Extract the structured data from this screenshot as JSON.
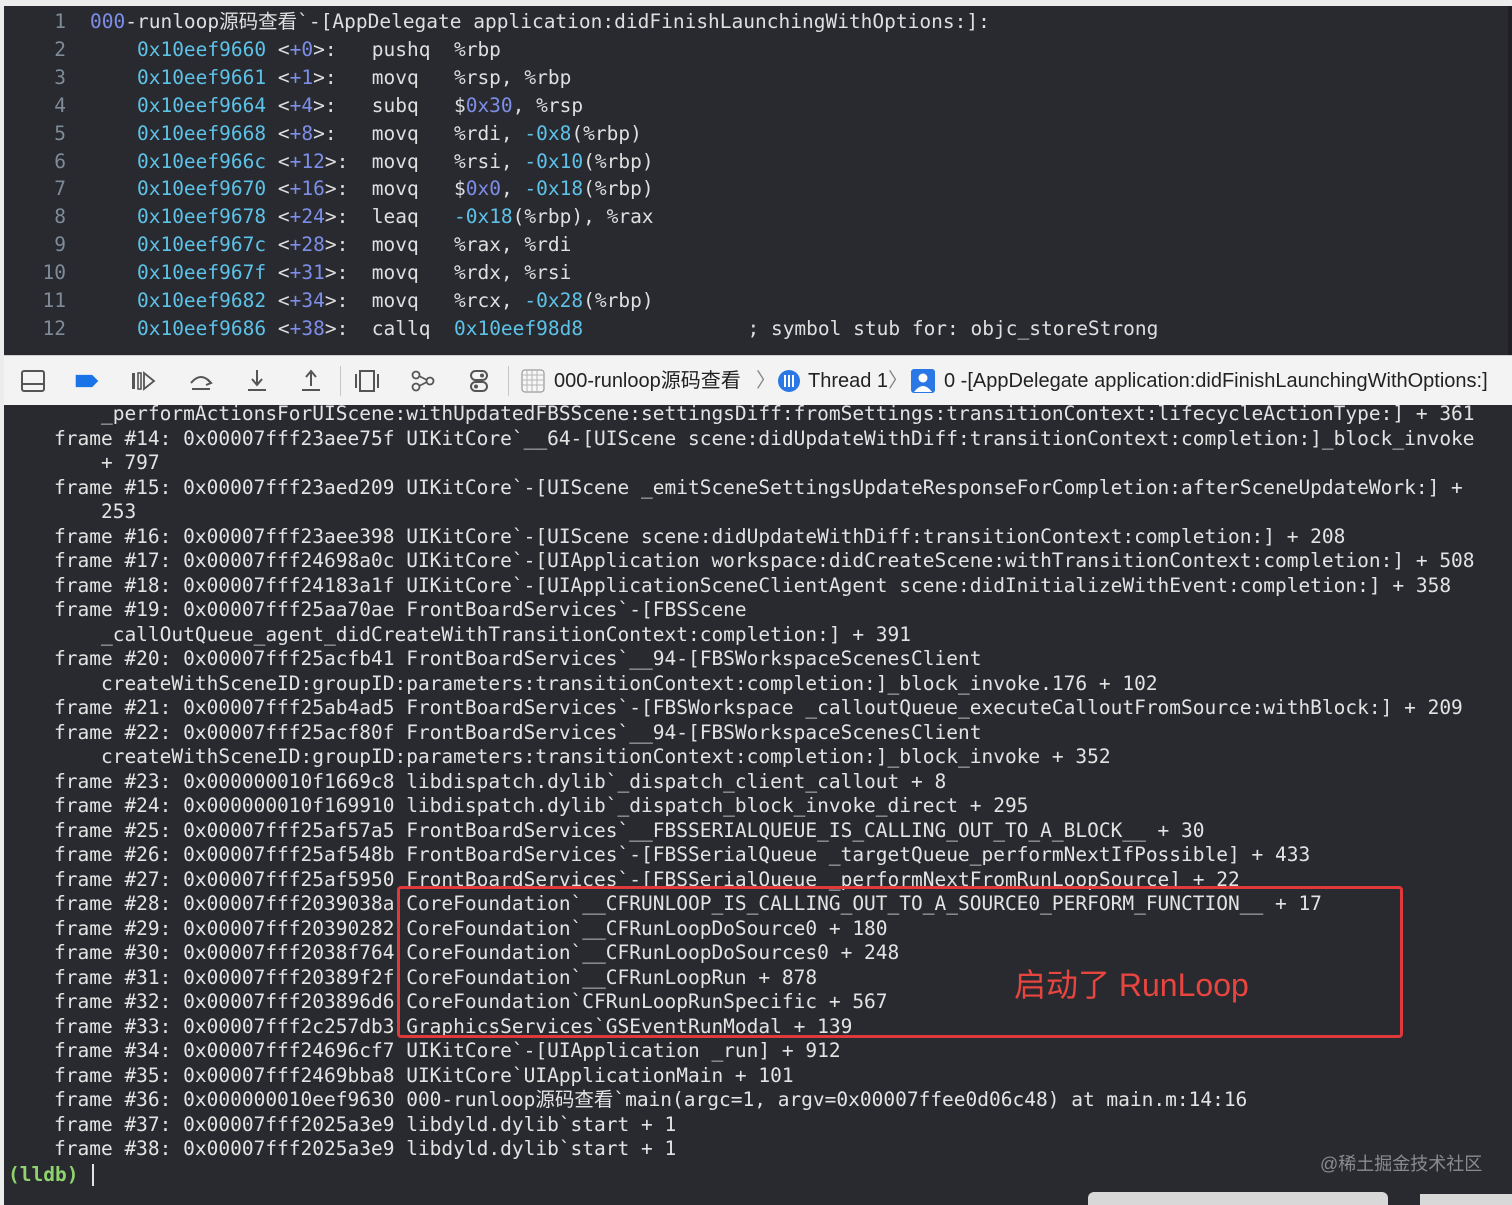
{
  "disassembly": {
    "lines": [
      {
        "n": "1",
        "segs": [
          [
            "num",
            "000"
          ],
          [
            "t",
            "-runloop源码查看`-[AppDelegate application:didFinishLaunchingWithOptions:]:"
          ]
        ]
      },
      {
        "n": "2",
        "segs": [
          [
            "t",
            "    "
          ],
          [
            "addr",
            "0x10eef9660"
          ],
          [
            "t",
            " <"
          ],
          [
            "num",
            "+0"
          ],
          [
            "t",
            ">:   pushq  %rbp"
          ]
        ]
      },
      {
        "n": "3",
        "segs": [
          [
            "t",
            "    "
          ],
          [
            "addr",
            "0x10eef9661"
          ],
          [
            "t",
            " <"
          ],
          [
            "num",
            "+1"
          ],
          [
            "t",
            ">:   movq   %rsp, %rbp"
          ]
        ]
      },
      {
        "n": "4",
        "segs": [
          [
            "t",
            "    "
          ],
          [
            "addr",
            "0x10eef9664"
          ],
          [
            "t",
            " <"
          ],
          [
            "num",
            "+4"
          ],
          [
            "t",
            ">:   subq   $"
          ],
          [
            "num",
            "0x30"
          ],
          [
            "t",
            ", %rsp"
          ]
        ]
      },
      {
        "n": "5",
        "segs": [
          [
            "t",
            "    "
          ],
          [
            "addr",
            "0x10eef9668"
          ],
          [
            "t",
            " <"
          ],
          [
            "num",
            "+8"
          ],
          [
            "t",
            ">:   movq   %rdi, "
          ],
          [
            "neg",
            "-0x8"
          ],
          [
            "t",
            "(%rbp)"
          ]
        ]
      },
      {
        "n": "6",
        "segs": [
          [
            "t",
            "    "
          ],
          [
            "addr",
            "0x10eef966c"
          ],
          [
            "t",
            " <"
          ],
          [
            "num",
            "+12"
          ],
          [
            "t",
            ">:  movq   %rsi, "
          ],
          [
            "neg",
            "-0x10"
          ],
          [
            "t",
            "(%rbp)"
          ]
        ]
      },
      {
        "n": "7",
        "segs": [
          [
            "t",
            "    "
          ],
          [
            "addr",
            "0x10eef9670"
          ],
          [
            "t",
            " <"
          ],
          [
            "num",
            "+16"
          ],
          [
            "t",
            ">:  movq   $"
          ],
          [
            "num",
            "0x0"
          ],
          [
            "t",
            ", "
          ],
          [
            "neg",
            "-0x18"
          ],
          [
            "t",
            "(%rbp)"
          ]
        ]
      },
      {
        "n": "8",
        "segs": [
          [
            "t",
            "    "
          ],
          [
            "addr",
            "0x10eef9678"
          ],
          [
            "t",
            " <"
          ],
          [
            "num",
            "+24"
          ],
          [
            "t",
            ">:  leaq   "
          ],
          [
            "neg",
            "-0x18"
          ],
          [
            "t",
            "(%rbp), %rax"
          ]
        ]
      },
      {
        "n": "9",
        "segs": [
          [
            "t",
            "    "
          ],
          [
            "addr",
            "0x10eef967c"
          ],
          [
            "t",
            " <"
          ],
          [
            "num",
            "+28"
          ],
          [
            "t",
            ">:  movq   %rax, %rdi"
          ]
        ]
      },
      {
        "n": "10",
        "segs": [
          [
            "t",
            "    "
          ],
          [
            "addr",
            "0x10eef967f"
          ],
          [
            "t",
            " <"
          ],
          [
            "num",
            "+31"
          ],
          [
            "t",
            ">:  movq   %rdx, %rsi"
          ]
        ]
      },
      {
        "n": "11",
        "segs": [
          [
            "t",
            "    "
          ],
          [
            "addr",
            "0x10eef9682"
          ],
          [
            "t",
            " <"
          ],
          [
            "num",
            "+34"
          ],
          [
            "t",
            ">:  movq   %rcx, "
          ],
          [
            "neg",
            "-0x28"
          ],
          [
            "t",
            "(%rbp)"
          ]
        ]
      },
      {
        "n": "12",
        "segs": [
          [
            "t",
            "    "
          ],
          [
            "addr",
            "0x10eef9686"
          ],
          [
            "t",
            " <"
          ],
          [
            "num",
            "+38"
          ],
          [
            "t",
            ">:  callq  "
          ],
          [
            "addr",
            "0x10eef98d8"
          ],
          [
            "t",
            "              ; symbol stub for: objc_storeStrong"
          ]
        ]
      }
    ]
  },
  "debug_bar": {
    "icons": [
      "hide-debug-area-icon",
      "breakpoint-toggle-icon",
      "continue-icon",
      "step-over-icon",
      "step-into-icon",
      "step-out-icon",
      "view-debugger-icon",
      "memory-graph-icon",
      "simulate-location-icon"
    ],
    "breadcrumb_target": "000-runloop源码查看",
    "breadcrumb_thread": "Thread 1",
    "breadcrumb_frame": "0 -[AppDelegate application:didFinishLaunchingWithOptions:]"
  },
  "console": {
    "lines": [
      "    _performActionsForUIScene:withUpdatedFBSScene:settingsDiff:fromSettings:transitionContext:lifecycleActionType:] + 361",
      "frame #14: 0x00007fff23aee75f UIKitCore`__64-[UIScene scene:didUpdateWithDiff:transitionContext:completion:]_block_invoke",
      "    + 797",
      "frame #15: 0x00007fff23aed209 UIKitCore`-[UIScene _emitSceneSettingsUpdateResponseForCompletion:afterSceneUpdateWork:] +",
      "    253",
      "frame #16: 0x00007fff23aee398 UIKitCore`-[UIScene scene:didUpdateWithDiff:transitionContext:completion:] + 208",
      "frame #17: 0x00007fff24698a0c UIKitCore`-[UIApplication workspace:didCreateScene:withTransitionContext:completion:] + 508",
      "frame #18: 0x00007fff24183a1f UIKitCore`-[UIApplicationSceneClientAgent scene:didInitializeWithEvent:completion:] + 358",
      "frame #19: 0x00007fff25aa70ae FrontBoardServices`-[FBSScene",
      "    _callOutQueue_agent_didCreateWithTransitionContext:completion:] + 391",
      "frame #20: 0x00007fff25acfb41 FrontBoardServices`__94-[FBSWorkspaceScenesClient",
      "    createWithSceneID:groupID:parameters:transitionContext:completion:]_block_invoke.176 + 102",
      "frame #21: 0x00007fff25ab4ad5 FrontBoardServices`-[FBSWorkspace _calloutQueue_executeCalloutFromSource:withBlock:] + 209",
      "frame #22: 0x00007fff25acf80f FrontBoardServices`__94-[FBSWorkspaceScenesClient",
      "    createWithSceneID:groupID:parameters:transitionContext:completion:]_block_invoke + 352",
      "frame #23: 0x000000010f1669c8 libdispatch.dylib`_dispatch_client_callout + 8",
      "frame #24: 0x000000010f169910 libdispatch.dylib`_dispatch_block_invoke_direct + 295",
      "frame #25: 0x00007fff25af57a5 FrontBoardServices`__FBSSERIALQUEUE_IS_CALLING_OUT_TO_A_BLOCK__ + 30",
      "frame #26: 0x00007fff25af548b FrontBoardServices`-[FBSSerialQueue _targetQueue_performNextIfPossible] + 433",
      "frame #27: 0x00007fff25af5950 FrontBoardServices`-[FBSSerialQueue _performNextFromRunLoopSource] + 22",
      "frame #28: 0x00007fff2039038a CoreFoundation`__CFRUNLOOP_IS_CALLING_OUT_TO_A_SOURCE0_PERFORM_FUNCTION__ + 17",
      "frame #29: 0x00007fff20390282 CoreFoundation`__CFRunLoopDoSource0 + 180",
      "frame #30: 0x00007fff2038f764 CoreFoundation`__CFRunLoopDoSources0 + 248",
      "frame #31: 0x00007fff20389f2f CoreFoundation`__CFRunLoopRun + 878",
      "frame #32: 0x00007fff203896d6 CoreFoundation`CFRunLoopRunSpecific + 567",
      "frame #33: 0x00007fff2c257db3 GraphicsServices`GSEventRunModal + 139",
      "frame #34: 0x00007fff24696cf7 UIKitCore`-[UIApplication _run] + 912",
      "frame #35: 0x00007fff2469bba8 UIKitCore`UIApplicationMain + 101",
      "frame #36: 0x000000010eef9630 000-runloop源码查看`main(argc=1, argv=0x00007ffee0d06c48) at main.m:14:16",
      "frame #37: 0x00007fff2025a3e9 libdyld.dylib`start + 1",
      "frame #38: 0x00007fff2025a3e9 libdyld.dylib`start + 1"
    ],
    "prompt": "(lldb)"
  },
  "annotation": {
    "text": "启动了 RunLoop",
    "color": "#e0393b"
  },
  "watermark": "@稀土掘金技术社区",
  "colors": {
    "background": "#292a30",
    "address": "#5dc2e8",
    "number": "#7d8ee8",
    "prompt": "#8ed36b",
    "highlight_border": "#e0393b"
  }
}
